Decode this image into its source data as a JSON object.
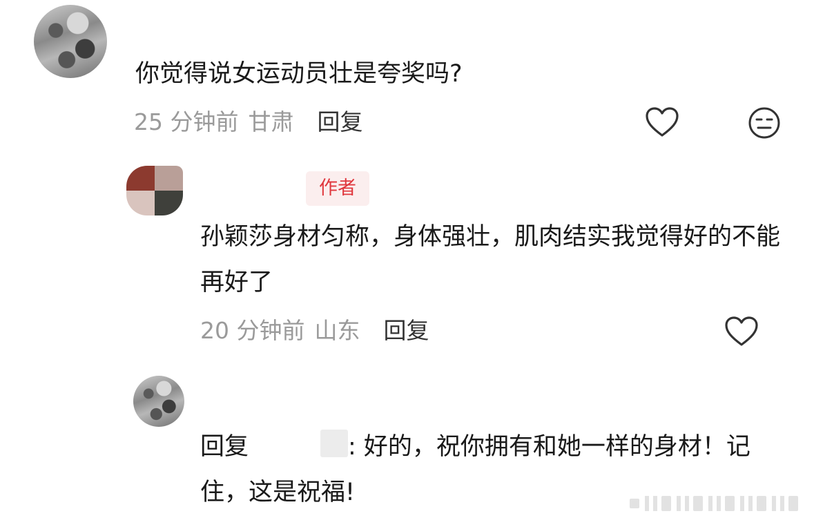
{
  "comments": [
    {
      "text": "你觉得说女运动员壮是夸奖吗?",
      "time": "25 分钟前",
      "location": "甘肃",
      "reply_label": "回复"
    },
    {
      "badge": "作者",
      "text": "孙颖莎身材匀称，身体强壮，肌肉结实我觉得好的不能再好了",
      "time": "20 分钟前",
      "location": "山东",
      "reply_label": "回复"
    },
    {
      "reply_prefix": "回复",
      "reply_suffix": ": 好的，祝你拥有和她一样的身材！记住，这是祝福!"
    }
  ],
  "icons": {
    "like": "heart-icon",
    "dislike": "meh-face-icon"
  },
  "colors": {
    "badge_text": "#e0383e",
    "badge_bg": "#fbeeee",
    "meta_text": "#9a9a9a"
  }
}
